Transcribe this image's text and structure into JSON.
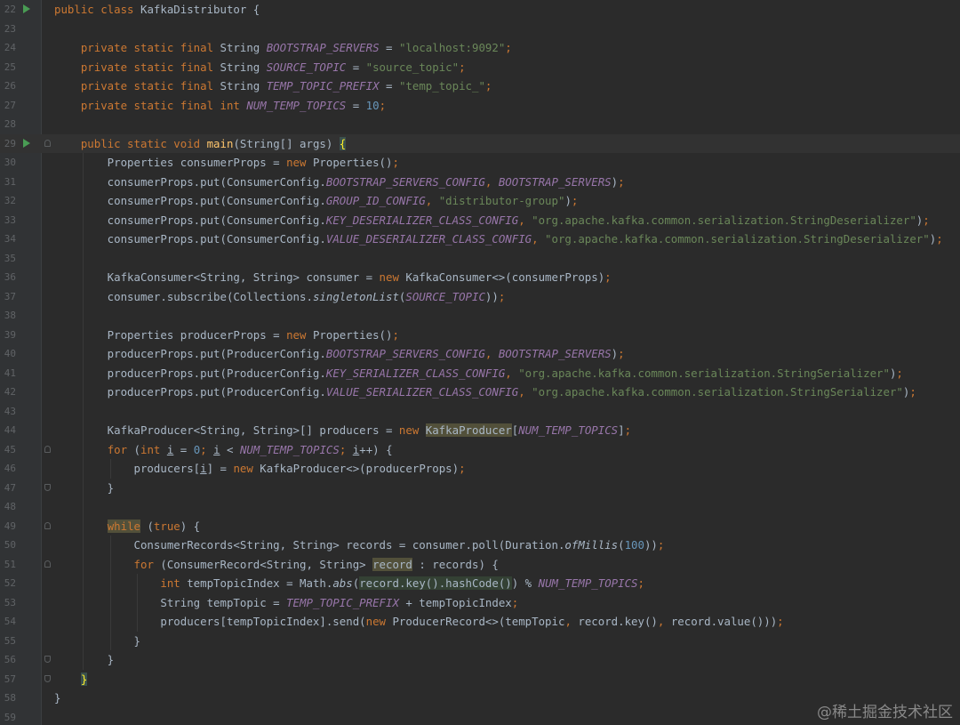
{
  "editor": {
    "language": "java",
    "current_line": 29,
    "colors": {
      "background": "#2b2b2b",
      "gutter": "#313335",
      "keyword": "#cc7832",
      "string": "#6a8759",
      "number": "#6897bb",
      "constant": "#9876aa",
      "method": "#ffc66d",
      "text": "#a9b7c6",
      "run_icon": "#499c54"
    },
    "lines": [
      {
        "num": "22",
        "run": true,
        "fold": null,
        "tokens": [
          {
            "t": "kw",
            "v": "public class "
          },
          {
            "t": "plain",
            "v": "KafkaDistributor {"
          }
        ]
      },
      {
        "num": "23",
        "run": false,
        "fold": null,
        "tokens": []
      },
      {
        "num": "24",
        "run": false,
        "fold": null,
        "tokens": [
          {
            "t": "plain",
            "v": "    "
          },
          {
            "t": "kw",
            "v": "private static final "
          },
          {
            "t": "plain",
            "v": "String "
          },
          {
            "t": "const",
            "v": "BOOTSTRAP_SERVERS"
          },
          {
            "t": "plain",
            "v": " = "
          },
          {
            "t": "str",
            "v": "\"localhost:9092\""
          },
          {
            "t": "kw",
            "v": ";"
          }
        ]
      },
      {
        "num": "25",
        "run": false,
        "fold": null,
        "tokens": [
          {
            "t": "plain",
            "v": "    "
          },
          {
            "t": "kw",
            "v": "private static final "
          },
          {
            "t": "plain",
            "v": "String "
          },
          {
            "t": "const",
            "v": "SOURCE_TOPIC"
          },
          {
            "t": "plain",
            "v": " = "
          },
          {
            "t": "str",
            "v": "\"source_topic\""
          },
          {
            "t": "kw",
            "v": ";"
          }
        ]
      },
      {
        "num": "26",
        "run": false,
        "fold": null,
        "tokens": [
          {
            "t": "plain",
            "v": "    "
          },
          {
            "t": "kw",
            "v": "private static final "
          },
          {
            "t": "plain",
            "v": "String "
          },
          {
            "t": "const",
            "v": "TEMP_TOPIC_PREFIX"
          },
          {
            "t": "plain",
            "v": " = "
          },
          {
            "t": "str",
            "v": "\"temp_topic_\""
          },
          {
            "t": "kw",
            "v": ";"
          }
        ]
      },
      {
        "num": "27",
        "run": false,
        "fold": null,
        "tokens": [
          {
            "t": "plain",
            "v": "    "
          },
          {
            "t": "kw",
            "v": "private static final int "
          },
          {
            "t": "const",
            "v": "NUM_TEMP_TOPICS"
          },
          {
            "t": "plain",
            "v": " = "
          },
          {
            "t": "num",
            "v": "10"
          },
          {
            "t": "kw",
            "v": ";"
          }
        ]
      },
      {
        "num": "28",
        "run": false,
        "fold": null,
        "tokens": []
      },
      {
        "num": "29",
        "run": true,
        "fold": "open",
        "tokens": [
          {
            "t": "plain",
            "v": "    "
          },
          {
            "t": "kw",
            "v": "public static void "
          },
          {
            "t": "fn",
            "v": "main"
          },
          {
            "t": "plain",
            "v": "(String[] args) "
          },
          {
            "t": "bracehl",
            "v": "{"
          }
        ]
      },
      {
        "num": "30",
        "run": false,
        "fold": null,
        "tokens": [
          {
            "t": "plain",
            "v": "        Properties consumerProps = "
          },
          {
            "t": "kw",
            "v": "new "
          },
          {
            "t": "plain",
            "v": "Properties()"
          },
          {
            "t": "kw",
            "v": ";"
          }
        ]
      },
      {
        "num": "31",
        "run": false,
        "fold": null,
        "tokens": [
          {
            "t": "plain",
            "v": "        consumerProps.put(ConsumerConfig."
          },
          {
            "t": "const",
            "v": "BOOTSTRAP_SERVERS_CONFIG"
          },
          {
            "t": "kw",
            "v": ", "
          },
          {
            "t": "const",
            "v": "BOOTSTRAP_SERVERS"
          },
          {
            "t": "plain",
            "v": ")"
          },
          {
            "t": "kw",
            "v": ";"
          }
        ]
      },
      {
        "num": "32",
        "run": false,
        "fold": null,
        "tokens": [
          {
            "t": "plain",
            "v": "        consumerProps.put(ConsumerConfig."
          },
          {
            "t": "const",
            "v": "GROUP_ID_CONFIG"
          },
          {
            "t": "kw",
            "v": ", "
          },
          {
            "t": "str",
            "v": "\"distributor-group\""
          },
          {
            "t": "plain",
            "v": ")"
          },
          {
            "t": "kw",
            "v": ";"
          }
        ]
      },
      {
        "num": "33",
        "run": false,
        "fold": null,
        "tokens": [
          {
            "t": "plain",
            "v": "        consumerProps.put(ConsumerConfig."
          },
          {
            "t": "const",
            "v": "KEY_DESERIALIZER_CLASS_CONFIG"
          },
          {
            "t": "kw",
            "v": ", "
          },
          {
            "t": "str",
            "v": "\"org.apache.kafka.common.serialization.StringDeserializer\""
          },
          {
            "t": "plain",
            "v": ")"
          },
          {
            "t": "kw",
            "v": ";"
          }
        ]
      },
      {
        "num": "34",
        "run": false,
        "fold": null,
        "tokens": [
          {
            "t": "plain",
            "v": "        consumerProps.put(ConsumerConfig."
          },
          {
            "t": "const",
            "v": "VALUE_DESERIALIZER_CLASS_CONFIG"
          },
          {
            "t": "kw",
            "v": ", "
          },
          {
            "t": "str",
            "v": "\"org.apache.kafka.common.serialization.StringDeserializer\""
          },
          {
            "t": "plain",
            "v": ")"
          },
          {
            "t": "kw",
            "v": ";"
          }
        ]
      },
      {
        "num": "35",
        "run": false,
        "fold": null,
        "tokens": []
      },
      {
        "num": "36",
        "run": false,
        "fold": null,
        "tokens": [
          {
            "t": "plain",
            "v": "        KafkaConsumer<String, String> consumer = "
          },
          {
            "t": "kw",
            "v": "new "
          },
          {
            "t": "plain",
            "v": "KafkaConsumer<>(consumerProps)"
          },
          {
            "t": "kw",
            "v": ";"
          }
        ]
      },
      {
        "num": "37",
        "run": false,
        "fold": null,
        "tokens": [
          {
            "t": "plain",
            "v": "        consumer.subscribe(Collections."
          },
          {
            "t": "static",
            "v": "singletonList"
          },
          {
            "t": "plain",
            "v": "("
          },
          {
            "t": "const",
            "v": "SOURCE_TOPIC"
          },
          {
            "t": "plain",
            "v": "))"
          },
          {
            "t": "kw",
            "v": ";"
          }
        ]
      },
      {
        "num": "38",
        "run": false,
        "fold": null,
        "tokens": []
      },
      {
        "num": "39",
        "run": false,
        "fold": null,
        "tokens": [
          {
            "t": "plain",
            "v": "        Properties producerProps = "
          },
          {
            "t": "kw",
            "v": "new "
          },
          {
            "t": "plain",
            "v": "Properties()"
          },
          {
            "t": "kw",
            "v": ";"
          }
        ]
      },
      {
        "num": "40",
        "run": false,
        "fold": null,
        "tokens": [
          {
            "t": "plain",
            "v": "        producerProps.put(ProducerConfig."
          },
          {
            "t": "const",
            "v": "BOOTSTRAP_SERVERS_CONFIG"
          },
          {
            "t": "kw",
            "v": ", "
          },
          {
            "t": "const",
            "v": "BOOTSTRAP_SERVERS"
          },
          {
            "t": "plain",
            "v": ")"
          },
          {
            "t": "kw",
            "v": ";"
          }
        ]
      },
      {
        "num": "41",
        "run": false,
        "fold": null,
        "tokens": [
          {
            "t": "plain",
            "v": "        producerProps.put(ProducerConfig."
          },
          {
            "t": "const",
            "v": "KEY_SERIALIZER_CLASS_CONFIG"
          },
          {
            "t": "kw",
            "v": ", "
          },
          {
            "t": "str",
            "v": "\"org.apache.kafka.common.serialization.StringSerializer\""
          },
          {
            "t": "plain",
            "v": ")"
          },
          {
            "t": "kw",
            "v": ";"
          }
        ]
      },
      {
        "num": "42",
        "run": false,
        "fold": null,
        "tokens": [
          {
            "t": "plain",
            "v": "        producerProps.put(ProducerConfig."
          },
          {
            "t": "const",
            "v": "VALUE_SERIALIZER_CLASS_CONFIG"
          },
          {
            "t": "kw",
            "v": ", "
          },
          {
            "t": "str",
            "v": "\"org.apache.kafka.common.serialization.StringSerializer\""
          },
          {
            "t": "plain",
            "v": ")"
          },
          {
            "t": "kw",
            "v": ";"
          }
        ]
      },
      {
        "num": "43",
        "run": false,
        "fold": null,
        "tokens": []
      },
      {
        "num": "44",
        "run": false,
        "fold": null,
        "tokens": [
          {
            "t": "plain",
            "v": "        KafkaProducer<String, String>[] producers = "
          },
          {
            "t": "kw",
            "v": "new "
          },
          {
            "t": "hl2",
            "v": "KafkaProducer"
          },
          {
            "t": "plain",
            "v": "["
          },
          {
            "t": "const",
            "v": "NUM_TEMP_TOPICS"
          },
          {
            "t": "plain",
            "v": "]"
          },
          {
            "t": "kw",
            "v": ";"
          }
        ]
      },
      {
        "num": "45",
        "run": false,
        "fold": "open",
        "tokens": [
          {
            "t": "plain",
            "v": "        "
          },
          {
            "t": "kw",
            "v": "for "
          },
          {
            "t": "plain",
            "v": "("
          },
          {
            "t": "kw",
            "v": "int "
          },
          {
            "t": "ul",
            "v": "i"
          },
          {
            "t": "plain",
            "v": " = "
          },
          {
            "t": "num",
            "v": "0"
          },
          {
            "t": "kw",
            "v": "; "
          },
          {
            "t": "ul",
            "v": "i"
          },
          {
            "t": "plain",
            "v": " < "
          },
          {
            "t": "const",
            "v": "NUM_TEMP_TOPICS"
          },
          {
            "t": "kw",
            "v": "; "
          },
          {
            "t": "ul",
            "v": "i"
          },
          {
            "t": "plain",
            "v": "++) {"
          }
        ]
      },
      {
        "num": "46",
        "run": false,
        "fold": null,
        "tokens": [
          {
            "t": "plain",
            "v": "            producers["
          },
          {
            "t": "ul",
            "v": "i"
          },
          {
            "t": "plain",
            "v": "] = "
          },
          {
            "t": "kw",
            "v": "new "
          },
          {
            "t": "plain",
            "v": "KafkaProducer<>(producerProps)"
          },
          {
            "t": "kw",
            "v": ";"
          }
        ]
      },
      {
        "num": "47",
        "run": false,
        "fold": "close",
        "tokens": [
          {
            "t": "plain",
            "v": "        }"
          }
        ]
      },
      {
        "num": "48",
        "run": false,
        "fold": null,
        "tokens": []
      },
      {
        "num": "49",
        "run": false,
        "fold": "open",
        "tokens": [
          {
            "t": "plain",
            "v": "        "
          },
          {
            "t": "kwhl",
            "v": "while"
          },
          {
            "t": "plain",
            "v": " ("
          },
          {
            "t": "kw",
            "v": "true"
          },
          {
            "t": "plain",
            "v": ") {"
          }
        ]
      },
      {
        "num": "50",
        "run": false,
        "fold": null,
        "tokens": [
          {
            "t": "plain",
            "v": "            ConsumerRecords<String, String> records = consumer.poll(Duration."
          },
          {
            "t": "static",
            "v": "ofMillis"
          },
          {
            "t": "plain",
            "v": "("
          },
          {
            "t": "num",
            "v": "100"
          },
          {
            "t": "plain",
            "v": "))"
          },
          {
            "t": "kw",
            "v": ";"
          }
        ]
      },
      {
        "num": "51",
        "run": false,
        "fold": "open",
        "tokens": [
          {
            "t": "plain",
            "v": "            "
          },
          {
            "t": "kw",
            "v": "for "
          },
          {
            "t": "plain",
            "v": "(ConsumerRecord<String, String> "
          },
          {
            "t": "hl2",
            "v": "record"
          },
          {
            "t": "plain",
            "v": " : records) {"
          }
        ]
      },
      {
        "num": "52",
        "run": false,
        "fold": null,
        "tokens": [
          {
            "t": "plain",
            "v": "                "
          },
          {
            "t": "kw",
            "v": "int "
          },
          {
            "t": "plain",
            "v": "tempTopicIndex = Math."
          },
          {
            "t": "static",
            "v": "abs"
          },
          {
            "t": "plain",
            "v": "("
          },
          {
            "t": "hl",
            "v": "record.key().hashCode()"
          },
          {
            "t": "plain",
            "v": ") % "
          },
          {
            "t": "const",
            "v": "NUM_TEMP_TOPICS"
          },
          {
            "t": "kw",
            "v": ";"
          }
        ]
      },
      {
        "num": "53",
        "run": false,
        "fold": null,
        "tokens": [
          {
            "t": "plain",
            "v": "                String tempTopic = "
          },
          {
            "t": "const",
            "v": "TEMP_TOPIC_PREFIX"
          },
          {
            "t": "plain",
            "v": " + tempTopicIndex"
          },
          {
            "t": "kw",
            "v": ";"
          }
        ]
      },
      {
        "num": "54",
        "run": false,
        "fold": null,
        "tokens": [
          {
            "t": "plain",
            "v": "                producers[tempTopicIndex].send("
          },
          {
            "t": "kw",
            "v": "new "
          },
          {
            "t": "plain",
            "v": "ProducerRecord<>(tempTopic"
          },
          {
            "t": "kw",
            "v": ", "
          },
          {
            "t": "plain",
            "v": "record.key()"
          },
          {
            "t": "kw",
            "v": ", "
          },
          {
            "t": "plain",
            "v": "record.value()))"
          },
          {
            "t": "kw",
            "v": ";"
          }
        ]
      },
      {
        "num": "55",
        "run": false,
        "fold": null,
        "tokens": [
          {
            "t": "plain",
            "v": "            }"
          }
        ]
      },
      {
        "num": "56",
        "run": false,
        "fold": "close",
        "tokens": [
          {
            "t": "plain",
            "v": "        }"
          }
        ]
      },
      {
        "num": "57",
        "run": false,
        "fold": "close",
        "tokens": [
          {
            "t": "plain",
            "v": "    "
          },
          {
            "t": "bracehl",
            "v": "}"
          }
        ]
      },
      {
        "num": "58",
        "run": false,
        "fold": null,
        "tokens": [
          {
            "t": "plain",
            "v": "}"
          }
        ]
      },
      {
        "num": "59",
        "run": false,
        "fold": null,
        "tokens": []
      }
    ]
  },
  "watermark": "@稀土掘金技术社区"
}
